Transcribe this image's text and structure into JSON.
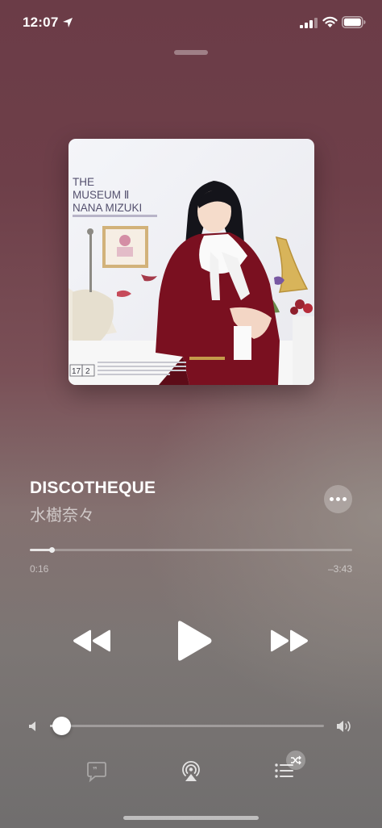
{
  "status_bar": {
    "time": "12:07",
    "location_icon": "location-arrow-icon",
    "signal_icon": "cellular-signal-icon",
    "wifi_icon": "wifi-icon",
    "battery_icon": "battery-icon"
  },
  "artwork": {
    "title_line1": "THE",
    "title_line2": "MUSEUM Ⅱ",
    "title_line3": "NANA MIZUKI",
    "catalog_a": "17",
    "catalog_b": "2"
  },
  "now_playing": {
    "title": "DISCOTHEQUE",
    "artist": "水樹奈々",
    "elapsed": "0:16",
    "remaining": "–3:43",
    "progress": 0.068,
    "volume": 0.04
  },
  "controls": {
    "more_icon": "more-ellipsis-icon",
    "rewind_icon": "rewind-icon",
    "play_icon": "play-icon",
    "forward_icon": "fast-forward-icon",
    "volume_low_icon": "volume-low-icon",
    "volume_high_icon": "volume-high-icon",
    "lyrics_icon": "lyrics-icon",
    "airplay_icon": "airplay-icon",
    "queue_icon": "queue-list-icon",
    "shuffle_icon": "shuffle-icon"
  },
  "colors": {
    "background_top": "#6b3c47",
    "background_bottom": "#706e6e"
  }
}
